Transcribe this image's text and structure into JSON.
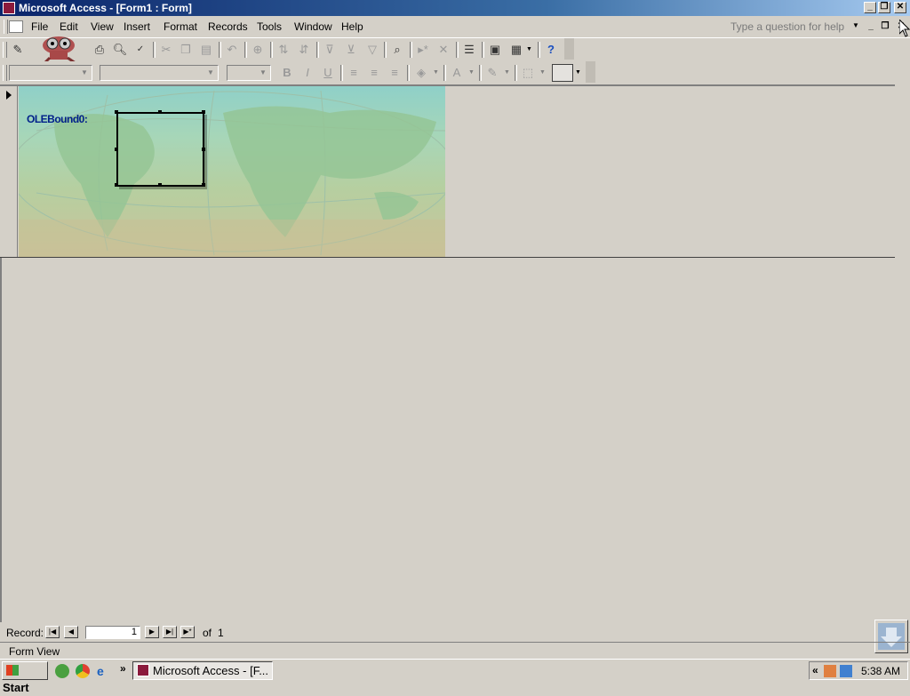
{
  "window": {
    "title": "Microsoft Access - [Form1 : Form]",
    "controls": {
      "minimize": "_",
      "restore": "❐",
      "close": "✕"
    }
  },
  "menubar": {
    "items": [
      "File",
      "Edit",
      "View",
      "Insert",
      "Format",
      "Records",
      "Tools",
      "Window",
      "Help"
    ],
    "help_placeholder": "Type a question for help"
  },
  "form": {
    "ole_label": "OLEBound0:"
  },
  "navigation": {
    "record_label": "Record:",
    "current_record": "1",
    "of_label": "of",
    "total_records": "1"
  },
  "statusbar": {
    "text": "Form View"
  },
  "taskbar": {
    "start_label": "Start",
    "task_label": "Microsoft Access - [F...",
    "overflow": "»",
    "tray_collapse": "«",
    "clock": "5:38 AM"
  },
  "icons": {
    "toolbar1": [
      "view-icon",
      "print-icon",
      "print-preview-icon",
      "spelling-icon",
      "cut-icon",
      "copy-icon",
      "paste-icon",
      "undo-icon",
      "hyperlink-icon",
      "sort-ascending-icon",
      "sort-descending-icon",
      "filter-by-selection-icon",
      "filter-by-form-icon",
      "apply-filter-icon",
      "find-icon",
      "new-record-icon",
      "delete-record-icon",
      "properties-icon",
      "database-window-icon",
      "new-object-icon",
      "help-icon"
    ],
    "toolbar2": [
      "bold-icon",
      "italic-icon",
      "underline-icon",
      "align-left-icon",
      "center-icon",
      "align-right-icon",
      "fill-color-icon",
      "font-color-icon",
      "line-color-icon",
      "line-width-icon",
      "special-effect-icon"
    ]
  },
  "colors": {
    "titlebar_start": "#0a246a",
    "titlebar_end": "#a6caf0",
    "face": "#d4d0c8",
    "label_blue": "#00208a"
  }
}
